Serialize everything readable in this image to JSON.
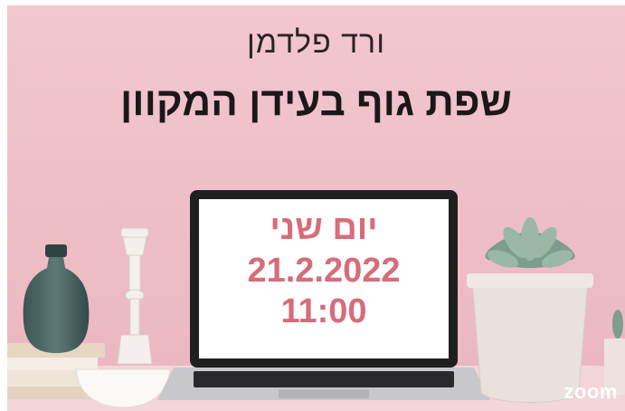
{
  "header": {
    "name": "ורד פלדמן",
    "title": "שפת גוף בעידן המקוון"
  },
  "screen": {
    "day": "יום שני",
    "date": "21.2.2022",
    "time": "11:00"
  },
  "branding": {
    "logo_text": "zoom"
  }
}
